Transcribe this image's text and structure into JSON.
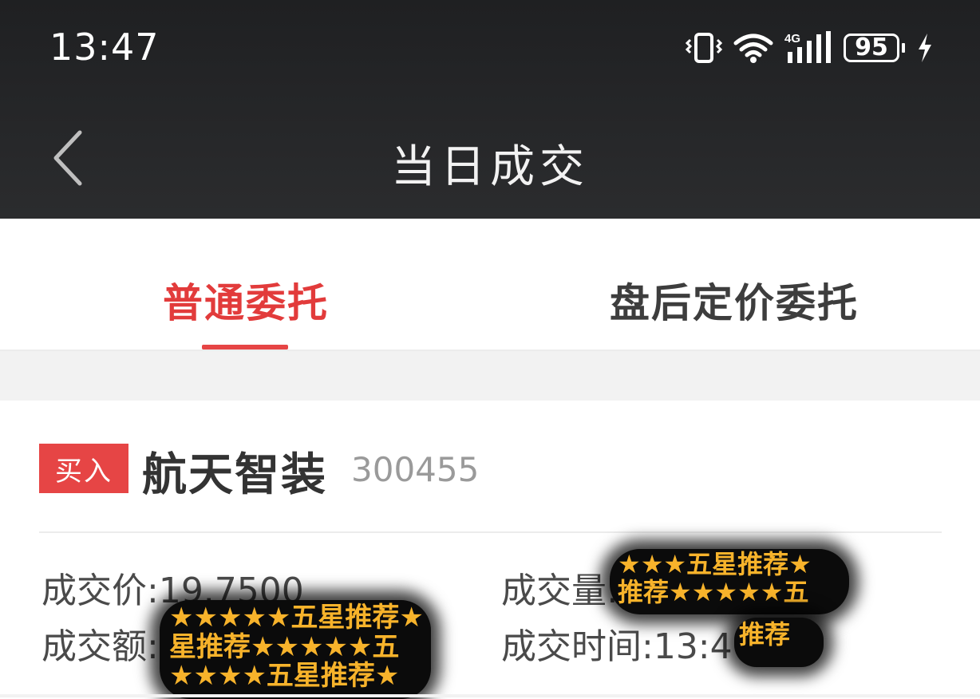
{
  "status_bar": {
    "time": "13:47",
    "network": "4G",
    "battery": "95",
    "icons": [
      "vibrate-icon",
      "wifi-icon",
      "signal-icon",
      "battery-icon",
      "charging-icon"
    ]
  },
  "header": {
    "title": "当日成交",
    "back_icon": "chevron-left-icon"
  },
  "tabs": [
    {
      "label": "普通委托",
      "active": true
    },
    {
      "label": "盘后定价委托",
      "active": false
    }
  ],
  "trade": {
    "side": "买入",
    "name": "航天智装",
    "code": "300455",
    "price_text": "成交价:19.7500",
    "volume_text": "成交量:",
    "amount_text": "成交额:",
    "time_text": "成交时间:13:4"
  },
  "stickers": {
    "line_a": "★★★★★五星推荐★",
    "line_b": "星推荐★★★★★五",
    "line_c": "★★★★五星推荐★",
    "line_d": "★★★五星推荐★",
    "line_e": "推荐★★★★★五",
    "line_f": "推荐"
  },
  "colors": {
    "accent": "#e64545",
    "header_bg": "#252628",
    "sticker_text": "#f7b32b"
  }
}
